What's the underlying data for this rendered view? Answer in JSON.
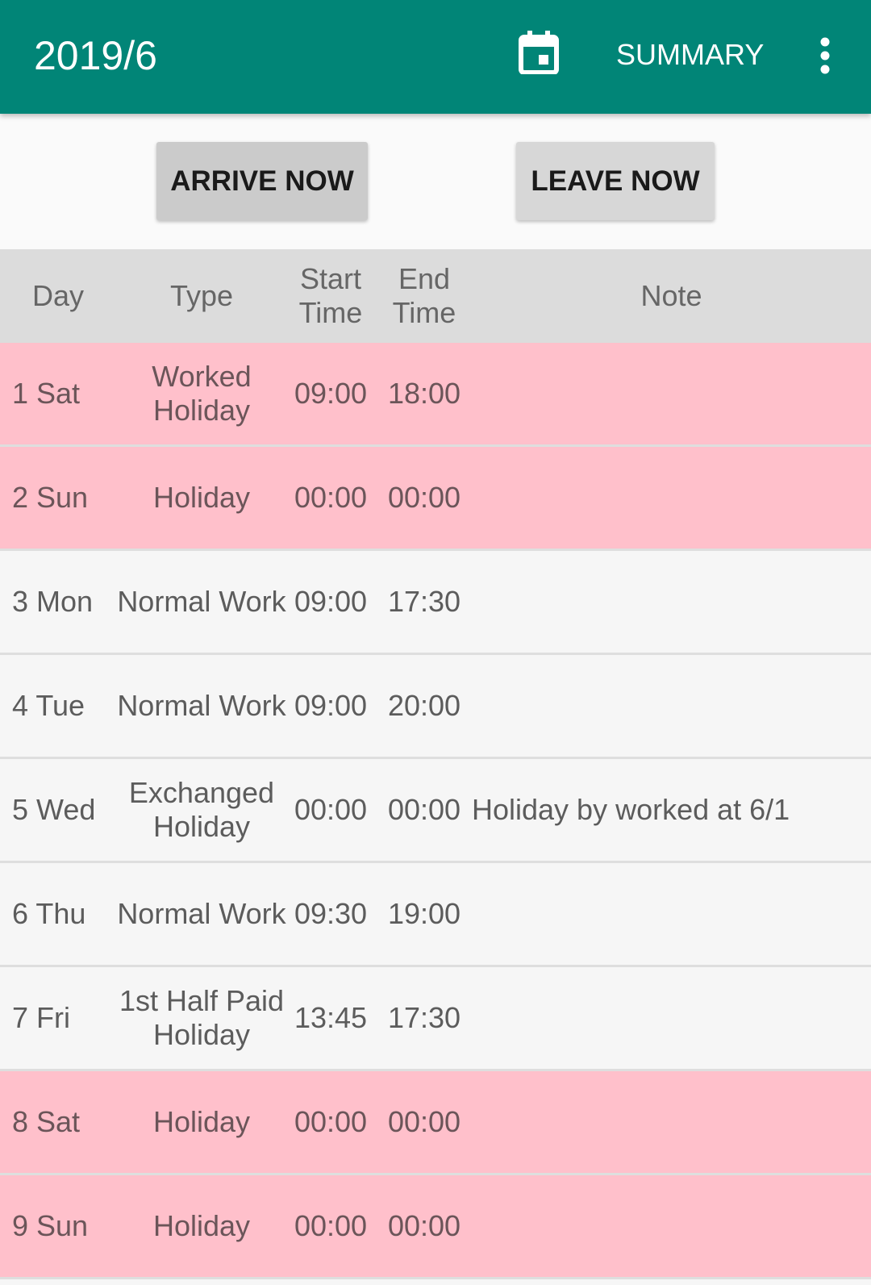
{
  "appbar": {
    "title": "2019/6",
    "summary_label": "SUMMARY",
    "calendar_icon": "calendar-icon",
    "more_icon": "more-vert-icon",
    "color": "#018577"
  },
  "buttons": {
    "arrive": "ARRIVE NOW",
    "leave": "LEAVE NOW"
  },
  "table": {
    "headers": {
      "day": "Day",
      "type": "Type",
      "start": "Start Time",
      "end": "End Time",
      "note": "Note"
    },
    "holiday_color": "#ffc0cb",
    "rows": [
      {
        "day": "1 Sat",
        "type": "Worked Holiday",
        "start": "09:00",
        "end": "18:00",
        "note": "",
        "holiday": true
      },
      {
        "day": "2 Sun",
        "type": "Holiday",
        "start": "00:00",
        "end": "00:00",
        "note": "",
        "holiday": true
      },
      {
        "day": "3 Mon",
        "type": "Normal Work",
        "start": "09:00",
        "end": "17:30",
        "note": "",
        "holiday": false
      },
      {
        "day": "4 Tue",
        "type": "Normal Work",
        "start": "09:00",
        "end": "20:00",
        "note": "",
        "holiday": false
      },
      {
        "day": "5 Wed",
        "type": "Exchanged Holiday",
        "start": "00:00",
        "end": "00:00",
        "note": "Holiday by worked at 6/1",
        "holiday": false
      },
      {
        "day": "6 Thu",
        "type": "Normal Work",
        "start": "09:30",
        "end": "19:00",
        "note": "",
        "holiday": false
      },
      {
        "day": "7 Fri",
        "type": "1st Half Paid Holiday",
        "start": "13:45",
        "end": "17:30",
        "note": "",
        "holiday": false
      },
      {
        "day": "8 Sat",
        "type": "Holiday",
        "start": "00:00",
        "end": "00:00",
        "note": "",
        "holiday": true
      },
      {
        "day": "9 Sun",
        "type": "Holiday",
        "start": "00:00",
        "end": "00:00",
        "note": "",
        "holiday": true
      }
    ]
  }
}
